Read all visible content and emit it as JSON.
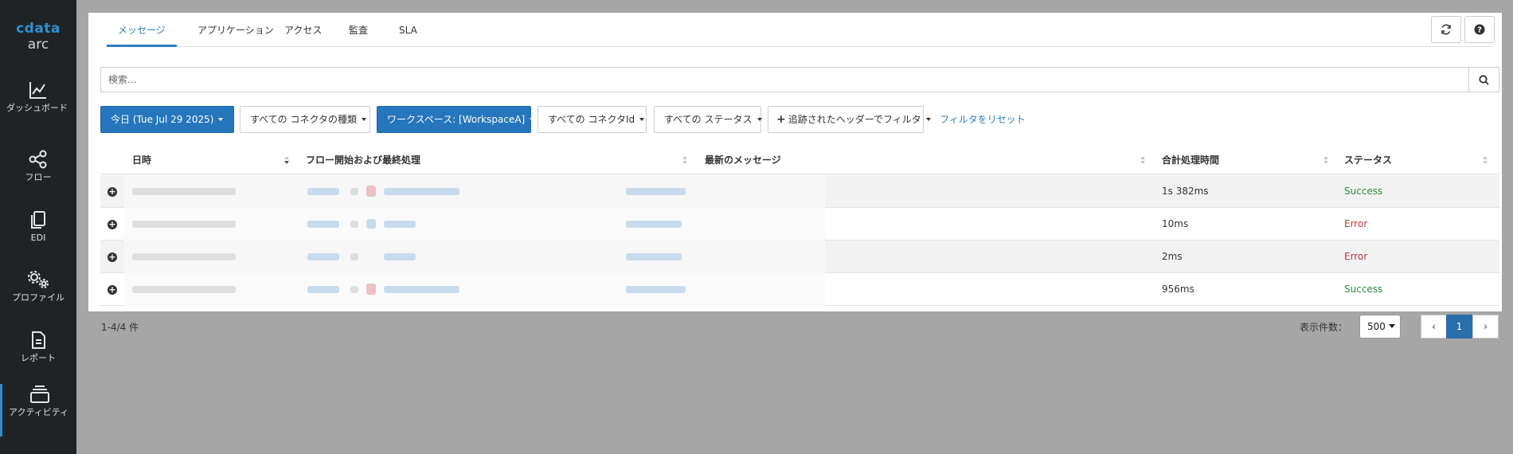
{
  "app": {
    "logo_main": "cdata",
    "logo_sub": "arc"
  },
  "sidebar": {
    "items": [
      {
        "label": "ダッシュボード",
        "icon": "chart-line-icon"
      },
      {
        "label": "フロー",
        "icon": "share-nodes-icon"
      },
      {
        "label": "EDI",
        "icon": "documents-icon"
      },
      {
        "label": "プロファイル",
        "icon": "gears-icon"
      },
      {
        "label": "レポート",
        "icon": "report-file-icon"
      },
      {
        "label": "アクティビティ",
        "icon": "stack-layers-icon"
      }
    ]
  },
  "tabs": [
    "メッセージ",
    "アプリケーション",
    "アクセス",
    "監査",
    "SLA"
  ],
  "search": {
    "placeholder": "検索..."
  },
  "filters": {
    "date": "今日 (Tue Jul 29 2025)",
    "connector_type": "すべての コネクタの種類",
    "workspace": "ワークスペース: [WorkspaceA]",
    "connector_id": "すべての コネクタId",
    "status": "すべての ステータス",
    "header_filter": "追跡されたヘッダーでフィルタ",
    "reset": "フィルタをリセット"
  },
  "table": {
    "columns": [
      "日時",
      "フロー開始および最終処理",
      "最新のメッセージ",
      "合計処理時間",
      "ステータス"
    ],
    "rows": [
      {
        "duration": "1s 382ms",
        "status": "Success",
        "status_type": "success"
      },
      {
        "duration": "10ms",
        "status": "Error",
        "status_type": "error"
      },
      {
        "duration": "2ms",
        "status": "Error",
        "status_type": "error"
      },
      {
        "duration": "956ms",
        "status": "Success",
        "status_type": "success"
      }
    ]
  },
  "pager": {
    "count": "1-4/4 件",
    "page_size_label": "表示件数：",
    "page_size": "500",
    "current_page": "1",
    "prev": "‹",
    "next": "›"
  },
  "colors": {
    "accent": "#2576bd",
    "success": "#2f8a3d",
    "error": "#c2353a",
    "sidebar_bg": "#1f2326"
  }
}
